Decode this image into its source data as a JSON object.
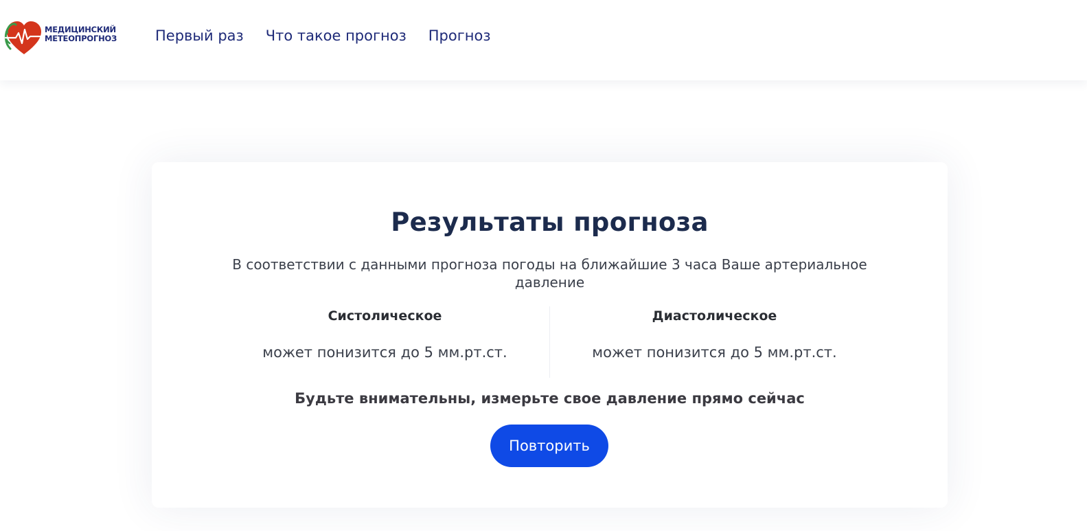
{
  "header": {
    "logo": {
      "line1": "МЕДИЦИНСКИЙ",
      "line2": "МЕТЕОПРОГНОЗ",
      "heart_color": "#d4351c",
      "leaf_color": "#3a9a4a",
      "text_color": "#1e2a78"
    },
    "nav": [
      {
        "label": "Первый раз"
      },
      {
        "label": "Что такое прогноз"
      },
      {
        "label": "Прогноз"
      }
    ]
  },
  "result": {
    "title": "Результаты прогноза",
    "description": "В соответствии с данными прогноза погоды на ближайшие 3 часа Ваше артериальное давление",
    "columns": [
      {
        "title": "Систолическое",
        "value": "может понизится до 5 мм.рт.ст."
      },
      {
        "title": "Диастолическое",
        "value": "может понизится до 5 мм.рт.ст."
      }
    ],
    "warning": "Будьте внимательны, измерьте свое давление прямо сейчас",
    "button_label": "Повторить",
    "button_color": "#0f4ae6"
  }
}
